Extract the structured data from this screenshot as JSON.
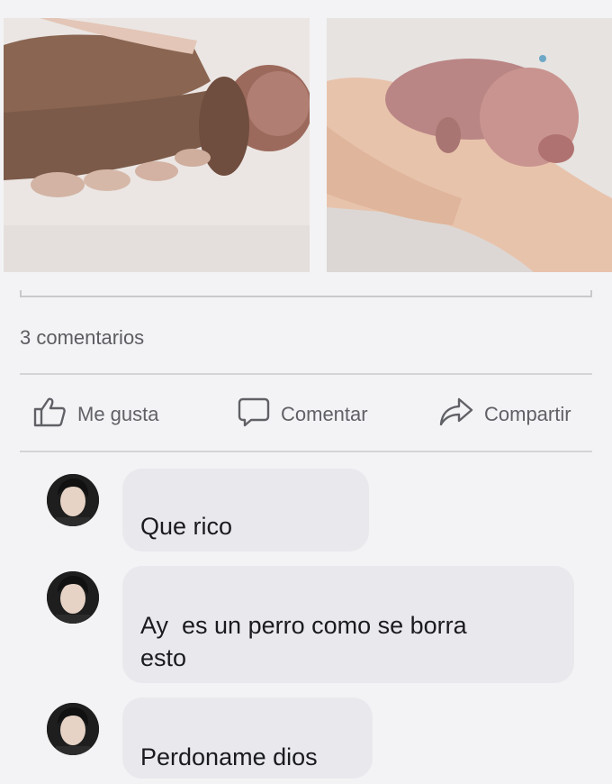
{
  "post": {
    "photos": [
      {
        "name": "left-photo"
      },
      {
        "name": "right-photo"
      }
    ],
    "comment_count_text": "3 comentarios",
    "actions": {
      "like_label": "Me gusta",
      "comment_label": "Comentar",
      "share_label": "Compartir"
    }
  },
  "comments": [
    {
      "text": "Que rico"
    },
    {
      "text_line1": "Ay  es un perro como se borra",
      "text_line2": "esto"
    },
    {
      "text": "Perdoname dios"
    }
  ],
  "colors": {
    "background": "#f3f3f5",
    "bubble": "#e9e9ed",
    "action_text": "#606166",
    "comment_text": "#1a1b1e",
    "divider": "#d4d4d8"
  },
  "icons": {
    "like": "thumbs-up-icon",
    "comment": "speech-bubble-icon",
    "share": "share-arrow-icon"
  }
}
